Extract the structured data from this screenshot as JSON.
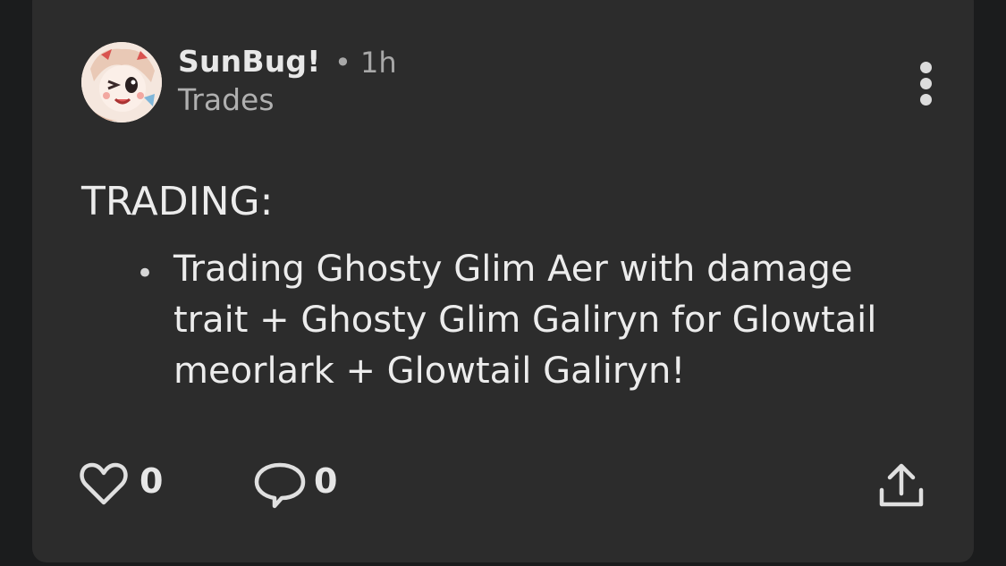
{
  "post": {
    "author": "SunBug!",
    "separator_time": "• 1h",
    "community": "Trades",
    "heading": "TRADING:",
    "bullet_items": [
      "Trading Ghosty Glim Aer with damage trait + Ghosty Glim Galiryn for Glowtail meorlark + Glowtail Galiryn!"
    ]
  },
  "actions": {
    "likes": "0",
    "comments": "0"
  },
  "icons": {
    "more": "more-vertical-icon",
    "like": "heart-icon",
    "comment": "comment-icon",
    "share": "share-icon"
  },
  "colors": {
    "card_bg": "#2c2c2c",
    "page_bg": "#1b1c1d",
    "text": "#ececec",
    "muted": "#a8a8a8"
  }
}
